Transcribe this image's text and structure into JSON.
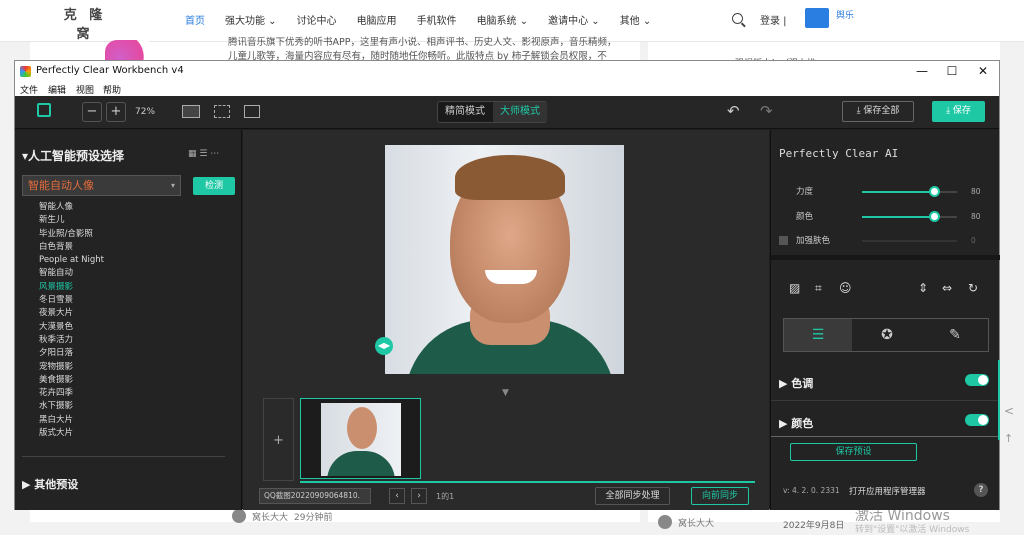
{
  "site": {
    "logo_text": "克 隆 窝",
    "nav": [
      "首页",
      "强大功能 ⌄",
      "讨论中心",
      "电脑应用",
      "手机软件",
      "电脑系统 ⌄",
      "邀请中心 ⌄",
      "其他 ⌄"
    ],
    "login": "登录 |",
    "signup_tag": "舆乐",
    "article_line1": "腾讯音乐旗下优秀的听书APP，这里有声小说、相声评书、历史人文、影视原声，音乐精频，",
    "article_line2": "儿童儿歌等，海量内容应有尽有，随时随地任你畅听。此版特点 by 柿子解锁会员权限，不",
    "side_snippet": "强悍版本！（强力推",
    "comment_user1": "窝长大大",
    "comment_time1": "29分钟前",
    "comment_user2": "窝长大大",
    "comment_date2": "2022年9月8日",
    "watermark_line1": "激活 Windows",
    "watermark_line2": "转到\"设置\"以激活 Windows"
  },
  "window": {
    "title": "Perfectly Clear Workbench v4",
    "controls": [
      "—",
      "☐",
      "✕"
    ],
    "menu": [
      "文件",
      "编辑",
      "视图",
      "帮助"
    ]
  },
  "toolbar": {
    "zoom_out": "−",
    "zoom_in": "+",
    "zoom_level": "72%",
    "mode_simple": "精简模式",
    "mode_master": "大师模式",
    "undo_icon": "undo-icon",
    "redo_icon": "redo-icon",
    "save_all": "⤓ 保存全部",
    "save": "⤓ 保存"
  },
  "left_panel": {
    "title": "▾人工智能预设选择",
    "icons": "▦ ☰ ⋯",
    "preset_selected": "智能自动人像",
    "detect_button": "检测",
    "presets": [
      "智能人像",
      "新生儿",
      "毕业照/合影照",
      "白色背景",
      "People at Night",
      "智能自动",
      "风景摄影",
      "冬日雪景",
      "夜景大片",
      "大漠景色",
      "秋季活力",
      "夕阳日落",
      "宠物摄影",
      "美食摄影",
      "花卉四季",
      "水下摄影",
      "黑白大片",
      "版式大片"
    ],
    "selected_index": 6,
    "other_presets": "▶  其他预设"
  },
  "canvas": {
    "file_name": "QQ截图20220909064810.",
    "page_info": "1的1",
    "sync_all": "全部同步处理",
    "sync_forward": "向前同步",
    "add_button": "+"
  },
  "right_panel": {
    "title": "Perfectly Clear AI",
    "sliders": [
      {
        "label": "力度",
        "value": "80",
        "fraction": 0.76
      },
      {
        "label": "颜色",
        "value": "80",
        "fraction": 0.76
      },
      {
        "label": "加强肤色",
        "value": "0",
        "fraction": 0
      }
    ],
    "sections": [
      {
        "label": "▶  色调"
      },
      {
        "label": "▶  颜色"
      }
    ],
    "save_preset": "保存预设",
    "version": "v: 4. 2. 0. 2331",
    "open_manager": "打开应用程序管理器",
    "help": "?"
  },
  "colors": {
    "accent": "#1ec8a5",
    "panel_bg": "#232323",
    "preset_orange": "#e36c3a",
    "site_blue": "#2a7de1"
  }
}
